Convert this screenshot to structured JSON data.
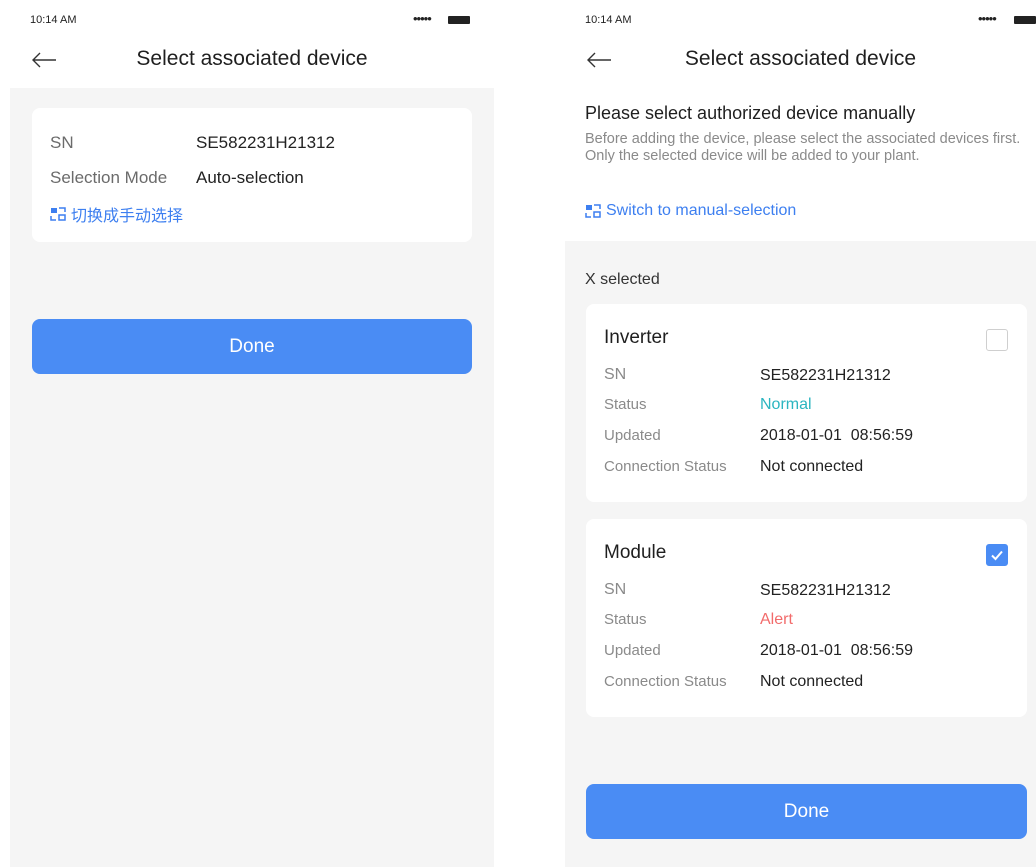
{
  "status_bar": {
    "time": "10:14 AM",
    "signal": "•••••"
  },
  "nav": {
    "title": "Select associated device"
  },
  "left": {
    "sn_label": "SN",
    "sn_value": "SE582231H21312",
    "mode_label": "Selection Mode",
    "mode_value": "Auto-selection",
    "switch_label": "切换成手动选择",
    "done_label": "Done"
  },
  "right": {
    "heading": "Please select authorized device manually",
    "description": "Before adding the device, please select the associated devices first. Only the selected device will be added to your plant.",
    "switch_label": "Switch to manual-selection",
    "selected_count": "X selected",
    "devices": [
      {
        "name": "Inverter",
        "checked": false,
        "sn_label": "SN",
        "sn": "SE582231H21312",
        "status_label": "Status",
        "status": "Normal",
        "status_color": "#2bb5c0",
        "updated_label": "Updated",
        "updated": "2018-01-01  08:56:59",
        "connection_label": "Connection Status",
        "connection": "Not connected"
      },
      {
        "name": "Module",
        "checked": true,
        "sn_label": "SN",
        "sn": "SE582231H21312",
        "status_label": "Status",
        "status": "Alert",
        "status_color": "#f26b6b",
        "updated_label": "Updated",
        "updated": "2018-01-01  08:56:59",
        "connection_label": "Connection Status",
        "connection": "Not connected"
      }
    ],
    "done_label": "Done"
  },
  "colors": {
    "accent": "#4a8cf4",
    "link": "#3d7ff0",
    "background": "#f5f5f5"
  }
}
